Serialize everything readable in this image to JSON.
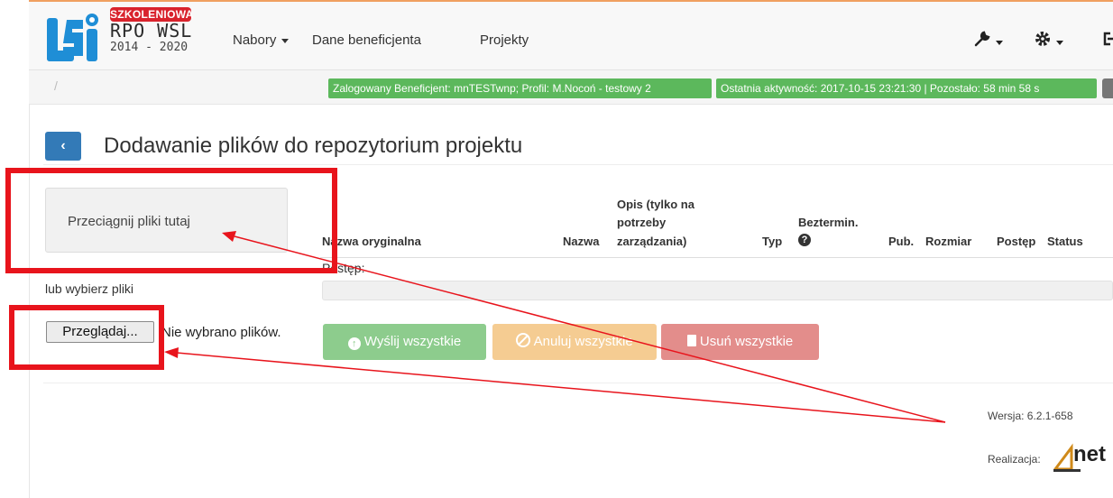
{
  "brand": {
    "badge": "SZKOLENIOWA",
    "rpo": "RPO WSL",
    "years": "2014 - 2020"
  },
  "nav": {
    "nabory": "Nabory",
    "dane": "Dane beneficjenta",
    "projekty": "Projekty"
  },
  "status": {
    "logged": "Zalogowany Beneficjent: mnTESTwnp; Profil: M.Nocoń - testowy 2",
    "activity": "Ostatnia aktywność: 2017-10-15 23:21:30 | Pozostało: 58 min 58 s"
  },
  "breadcrumb": "/",
  "page": {
    "title": "Dodawanie plików do repozytorium projektu"
  },
  "upload": {
    "dropzone": "Przeciągnij pliki tutaj",
    "or_select": "lub wybierz pliki",
    "browse": "Przeglądaj...",
    "no_file": "Nie wybrano plików.",
    "progress_label": "Postęp:"
  },
  "table": {
    "col_original": "Nazwa oryginalna",
    "col_name": "Nazwa",
    "col_desc_1": "Opis (tylko na",
    "col_desc_2": "potrzeby",
    "col_desc_3": "zarządzania)",
    "col_type": "Typ",
    "col_unlimited": "Beztermin.",
    "col_pub": "Pub.",
    "col_size": "Rozmiar",
    "col_progress": "Postęp",
    "col_status": "Status"
  },
  "actions": {
    "send_all": "Wyślij wszystkie",
    "cancel_all": "Anuluj wszystkie",
    "delete_all": "Usuń wszystkie"
  },
  "footer": {
    "version": "Wersja: 6.2.1-658",
    "realization": "Realizacja:",
    "company": "net"
  },
  "colors": {
    "primary": "#337ab7",
    "success": "#5cb85c",
    "warning": "#f0ad4e",
    "danger": "#d9534f",
    "annotation": "#e8141c"
  }
}
